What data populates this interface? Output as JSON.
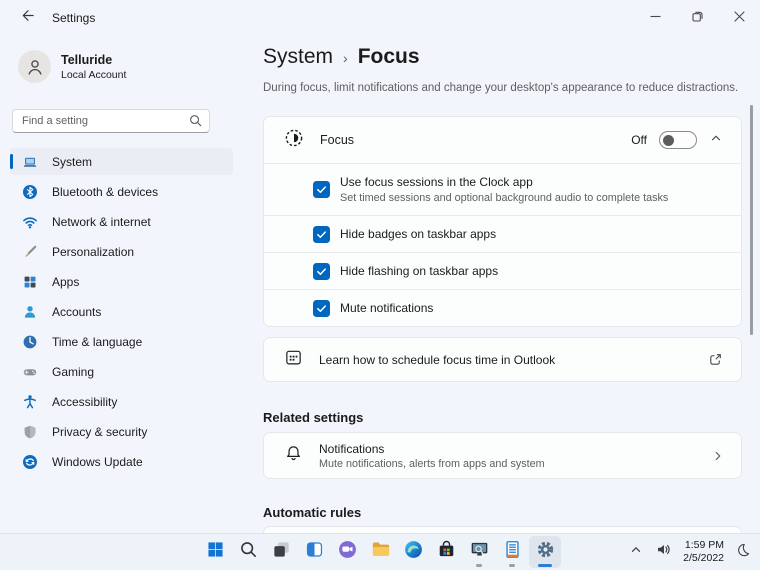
{
  "window": {
    "title": "Settings",
    "controls": {
      "minimize": "minimize",
      "restore": "restore",
      "close": "close"
    }
  },
  "sidebar": {
    "profile": {
      "name": "Telluride",
      "type": "Local Account"
    },
    "search": {
      "placeholder": "Find a setting",
      "icon": "search-icon"
    },
    "items": [
      {
        "label": "System",
        "icon": "laptop-icon",
        "selected": true
      },
      {
        "label": "Bluetooth & devices",
        "icon": "bluetooth-icon",
        "selected": false
      },
      {
        "label": "Network & internet",
        "icon": "wifi-icon",
        "selected": false
      },
      {
        "label": "Personalization",
        "icon": "brush-icon",
        "selected": false
      },
      {
        "label": "Apps",
        "icon": "apps-grid-icon",
        "selected": false
      },
      {
        "label": "Accounts",
        "icon": "person-icon",
        "selected": false
      },
      {
        "label": "Time & language",
        "icon": "clock-globe-icon",
        "selected": false
      },
      {
        "label": "Gaming",
        "icon": "gamepad-icon",
        "selected": false
      },
      {
        "label": "Accessibility",
        "icon": "accessibility-icon",
        "selected": false
      },
      {
        "label": "Privacy & security",
        "icon": "shield-icon",
        "selected": false
      },
      {
        "label": "Windows Update",
        "icon": "update-arrows-icon",
        "selected": false
      }
    ]
  },
  "main": {
    "breadcrumb": {
      "parent": "System",
      "separator": "›",
      "current": "Focus"
    },
    "description": "During focus, limit notifications and change your desktop's appearance to reduce distractions.",
    "focus_card": {
      "title": "Focus",
      "icon": "focus-moon-icon",
      "state": "Off",
      "expanded": true,
      "options": [
        {
          "label": "Use focus sessions in the Clock app",
          "description": "Set timed sessions and optional background audio to complete tasks",
          "checked": true
        },
        {
          "label": "Hide badges on taskbar apps",
          "checked": true
        },
        {
          "label": "Hide flashing on taskbar apps",
          "checked": true
        },
        {
          "label": "Mute notifications",
          "checked": true
        }
      ]
    },
    "outlook_link": {
      "label": "Learn how to schedule focus time in Outlook",
      "icon": "calendar-icon",
      "trailing_icon": "external-link-icon"
    },
    "related": {
      "heading": "Related settings",
      "notifications": {
        "title": "Notifications",
        "description": "Mute notifications, alerts from apps and system",
        "icon": "bell-icon"
      }
    },
    "automatic_rules": {
      "heading": "Automatic rules"
    }
  },
  "taskbar": {
    "items": [
      {
        "name": "start",
        "icon": "windows-start-icon"
      },
      {
        "name": "search",
        "icon": "search-icon"
      },
      {
        "name": "task-view",
        "icon": "task-view-icon"
      },
      {
        "name": "widgets",
        "icon": "widgets-icon"
      },
      {
        "name": "chat",
        "icon": "chat-video-icon"
      },
      {
        "name": "file-explorer",
        "icon": "folder-icon"
      },
      {
        "name": "edge",
        "icon": "edge-browser-icon"
      },
      {
        "name": "store",
        "icon": "store-bag-icon"
      },
      {
        "name": "screen-tool",
        "icon": "monitor-magnifier-icon",
        "running": true
      },
      {
        "name": "notes",
        "icon": "notepad-icon",
        "running": true
      },
      {
        "name": "settings",
        "icon": "gear-icon",
        "running": true,
        "active": true
      }
    ],
    "tray": {
      "hidden_icons": "chevron-up-icon",
      "volume": "speaker-icon",
      "time": "1:59 PM",
      "date": "2/5/2022",
      "focus_assist": "moon-icon"
    }
  },
  "colors": {
    "accent": "#0067c0",
    "checkbox": "#0067c0",
    "app_background": "#f2f5fb",
    "card_background": "#fcfdfd",
    "taskbar_background": "#eef2f9",
    "selected_nav": "#eaeef4",
    "active_underline": "#2b7fd6"
  }
}
